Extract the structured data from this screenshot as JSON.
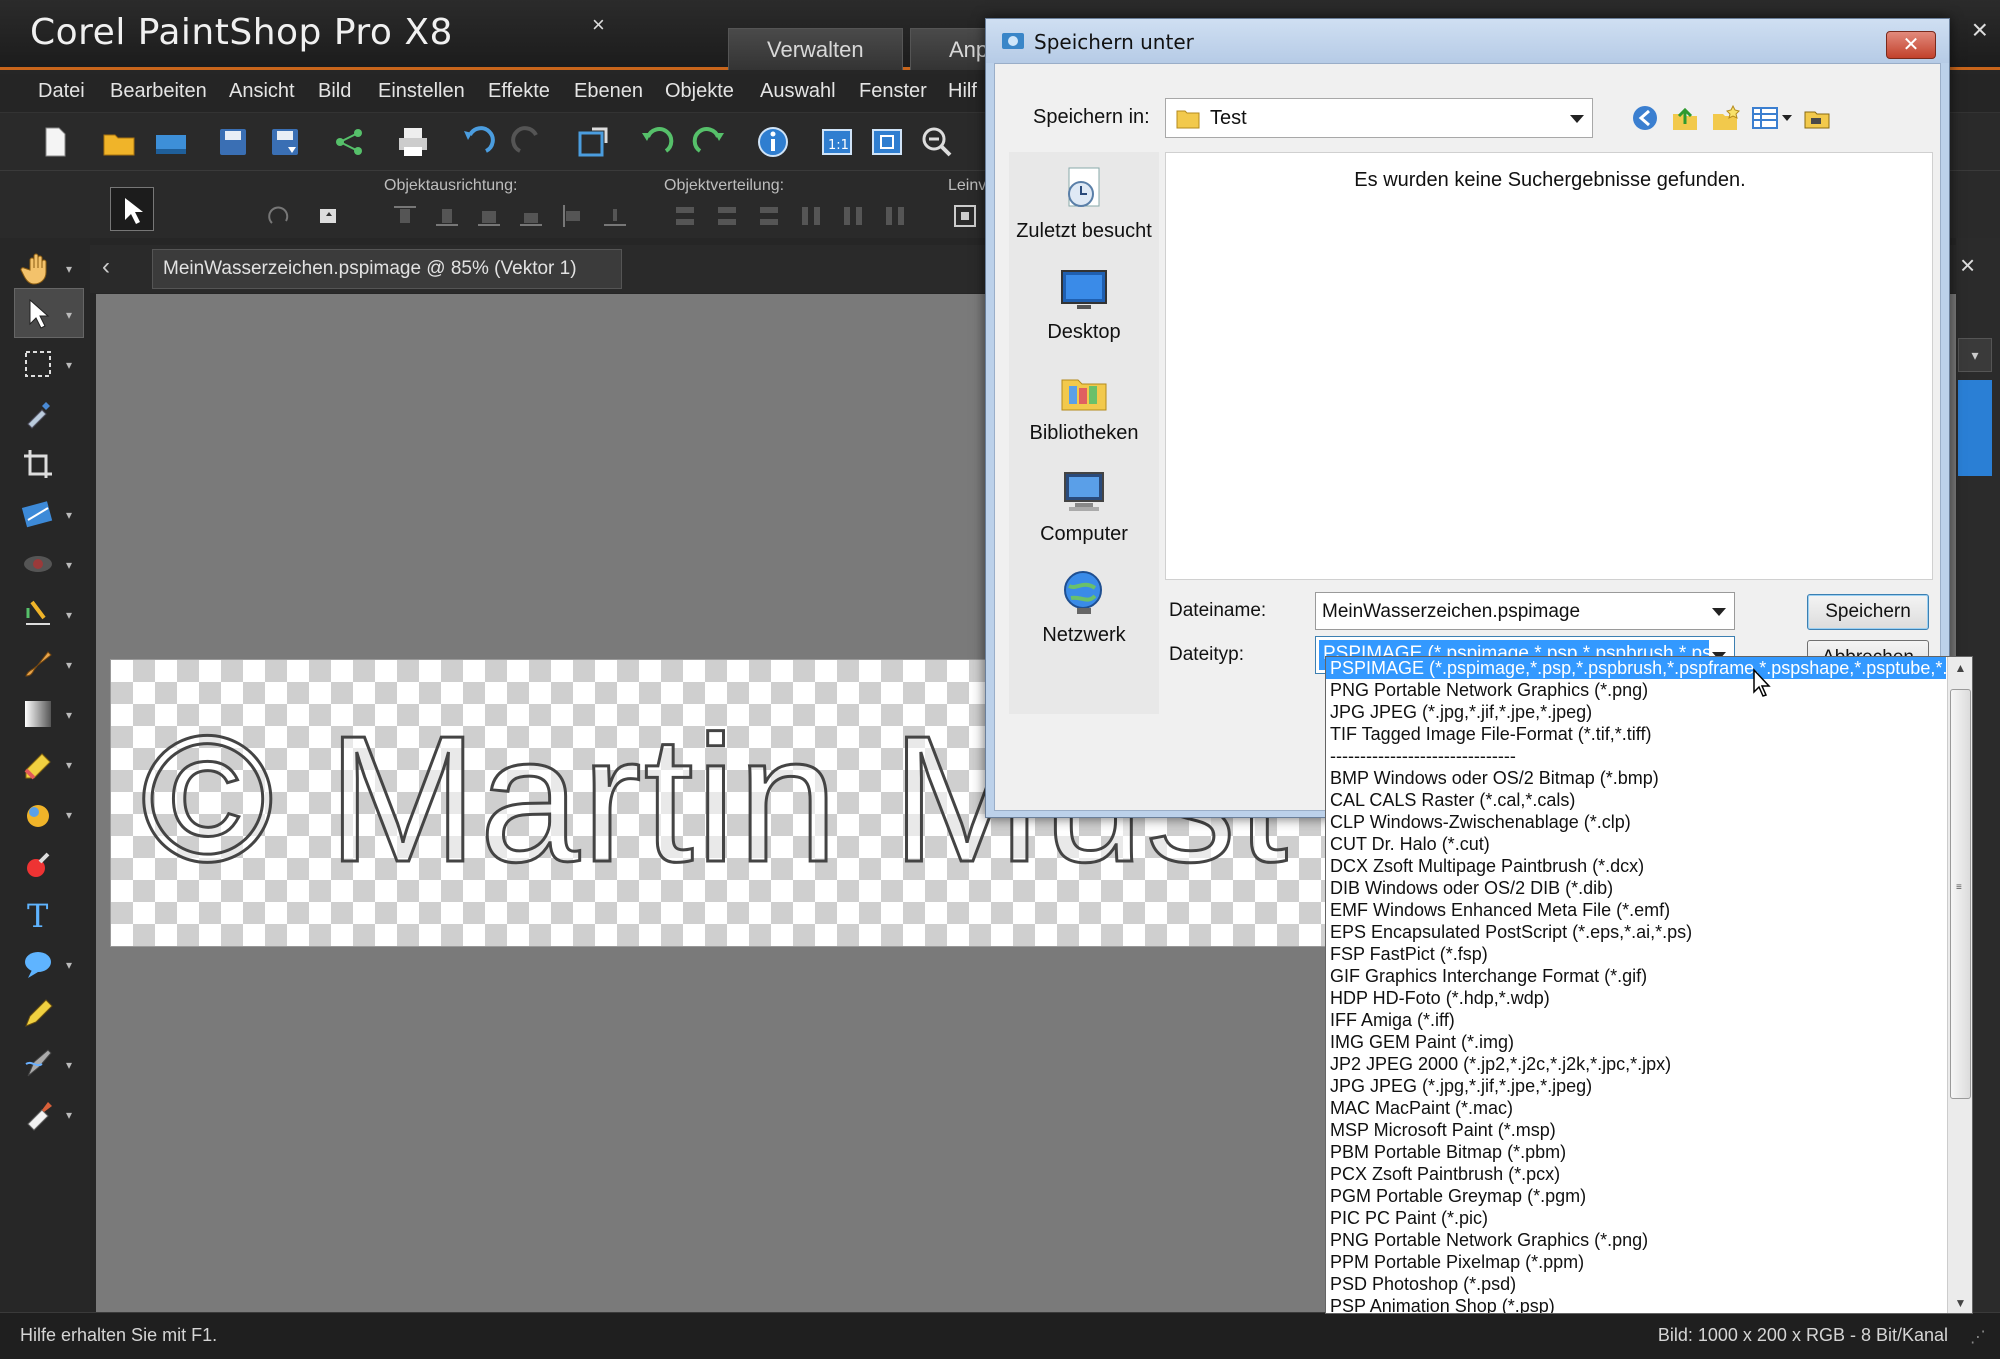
{
  "app": {
    "title": "Corel PaintShop Pro X8",
    "workspace_tabs": [
      "Verwalten",
      "Anp"
    ],
    "window_close": "×",
    "menu": [
      "Datei",
      "Bearbeiten",
      "Ansicht",
      "Bild",
      "Einstellen",
      "Effekte",
      "Ebenen",
      "Objekte",
      "Auswahl",
      "Fenster",
      "Hilf"
    ],
    "toolbar2_labels": {
      "align": "Objektausrichtung:",
      "distribute": "Objektverteilung:",
      "canvas": "Leinv"
    },
    "doc_tab": {
      "label": "MeinWasserzeichen.pspimage @  85% (Vektor 1)",
      "close": "×"
    },
    "watermark_text": "© Martin Must",
    "right_close": "×",
    "status": {
      "left": "Hilfe erhalten Sie mit F1.",
      "right": "Bild:  1000 x 200 x RGB - 8 Bit/Kanal"
    },
    "colors": {
      "accent": "#c8651b",
      "selection": "#3399ff",
      "canvas_bg": "#7a7a7a"
    }
  },
  "dialog": {
    "title": "Speichern unter",
    "close": "✕",
    "save_in_label": "Speichern in:",
    "save_in_value": "Test",
    "empty_message": "Es wurden keine Suchergebnisse gefunden.",
    "places": [
      "Zuletzt besucht",
      "Desktop",
      "Bibliotheken",
      "Computer",
      "Netzwerk"
    ],
    "filename_label": "Dateiname:",
    "filename_value": "MeinWasserzeichen.pspimage",
    "filetype_label": "Dateityp:",
    "filetype_value": "PSPIMAGE (*.pspimage,*.psp,*.pspbrush,*.pspfr",
    "save_button": "Speichern",
    "cancel_button": "Abbrechen"
  },
  "filetype_list": {
    "selected_index": 0,
    "items": [
      "PSPIMAGE (*.pspimage,*.psp,*.pspbrush,*.pspframe,*.pspshape,*.psptube,*.b",
      "PNG Portable Network Graphics (*.png)",
      "JPG JPEG  (*.jpg,*.jif,*.jpe,*.jpeg)",
      "TIF Tagged Image File-Format (*.tif,*.tiff)",
      "-------------------------------",
      "BMP Windows oder OS/2 Bitmap (*.bmp)",
      "CAL CALS Raster (*.cal,*.cals)",
      "CLP Windows-Zwischenablage (*.clp)",
      "CUT Dr. Halo (*.cut)",
      "DCX Zsoft Multipage Paintbrush (*.dcx)",
      "DIB Windows oder OS/2 DIB (*.dib)",
      "EMF Windows Enhanced Meta File (*.emf)",
      "EPS Encapsulated PostScript (*.eps,*.ai,*.ps)",
      "FSP FastPict (*.fsp)",
      "GIF Graphics Interchange Format (*.gif)",
      "HDP HD-Foto (*.hdp,*.wdp)",
      "IFF Amiga (*.iff)",
      "IMG GEM Paint (*.img)",
      "JP2 JPEG 2000 (*.jp2,*.j2c,*.j2k,*.jpc,*.jpx)",
      "JPG JPEG  (*.jpg,*.jif,*.jpe,*.jpeg)",
      "MAC MacPaint (*.mac)",
      "MSP Microsoft Paint (*.msp)",
      "PBM Portable Bitmap (*.pbm)",
      "PCX Zsoft Paintbrush (*.pcx)",
      "PGM Portable Greymap (*.pgm)",
      "PIC PC Paint (*.pic)",
      "PNG Portable Network Graphics (*.png)",
      "PPM Portable Pixelmap (*.ppm)",
      "PSD Photoshop (*.psd)",
      "PSP Animation Shop (*.psp)"
    ]
  }
}
